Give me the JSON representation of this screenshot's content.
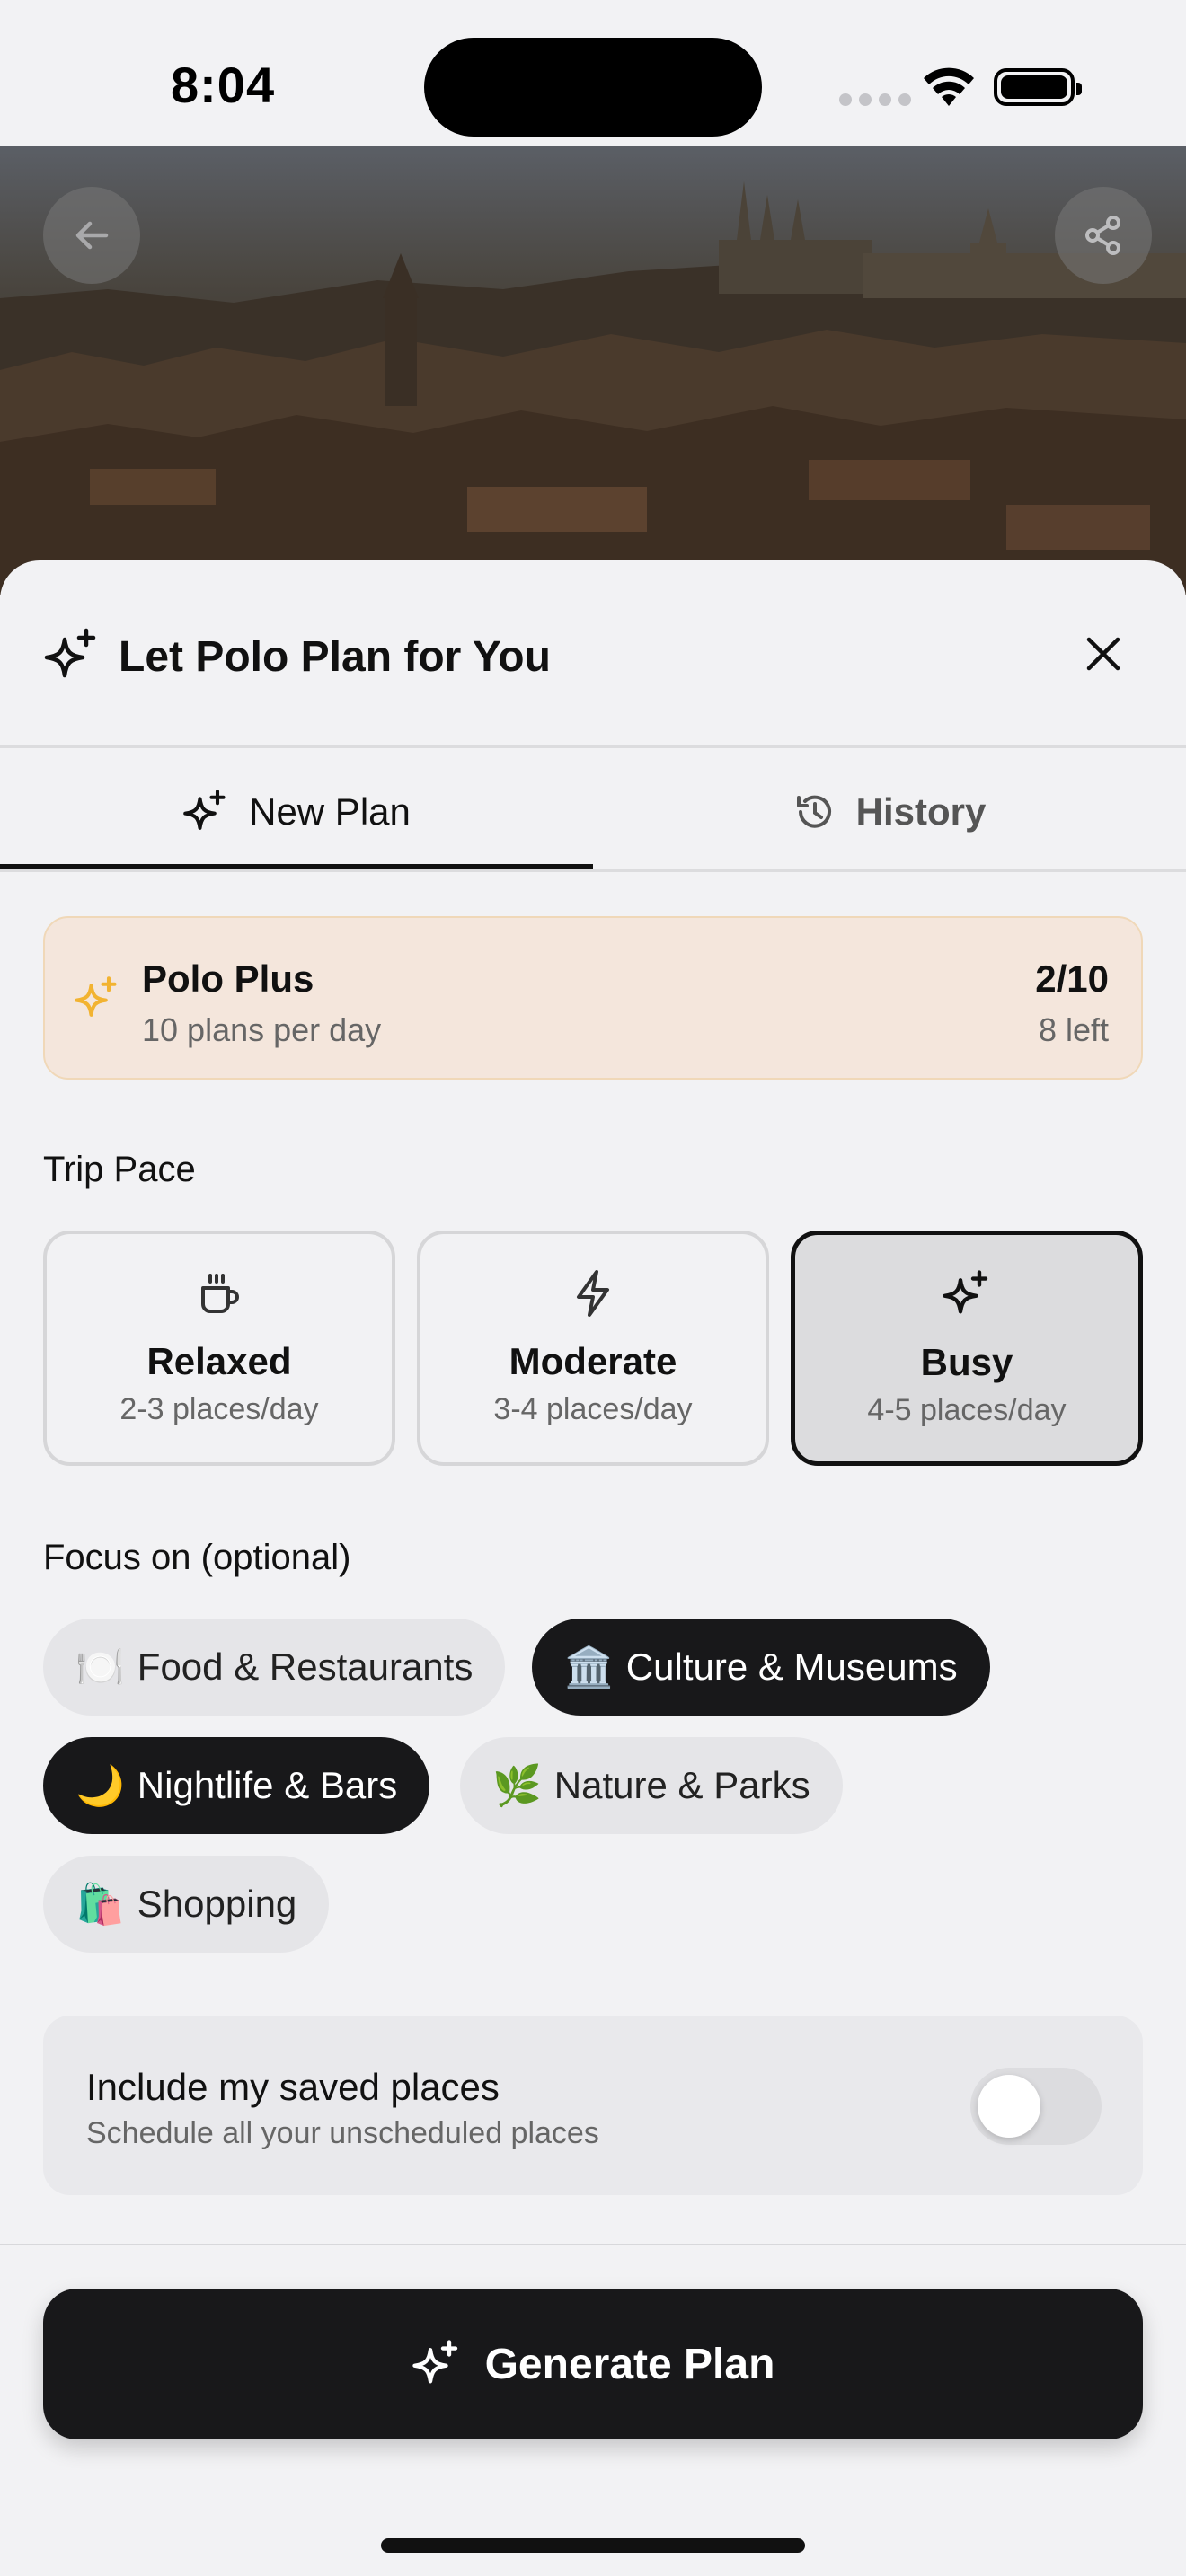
{
  "status_bar": {
    "time": "8:04"
  },
  "sheet": {
    "title": "Let Polo Plan for You",
    "tabs": [
      {
        "label": "New Plan",
        "icon": "sparkles-icon",
        "selected": true
      },
      {
        "label": "History",
        "icon": "history-icon",
        "selected": false
      }
    ]
  },
  "plan_card": {
    "name": "Polo Plus",
    "description": "10 plans per day",
    "used": "2/10",
    "remaining": "8 left",
    "accent": "#f2b331"
  },
  "trip_pace": {
    "label": "Trip Pace",
    "options": [
      {
        "name": "Relaxed",
        "detail": "2-3 places/day",
        "icon": "coffee-cup-icon",
        "selected": false
      },
      {
        "name": "Moderate",
        "detail": "3-4 places/day",
        "icon": "lightning-icon",
        "selected": false
      },
      {
        "name": "Busy",
        "detail": "4-5 places/day",
        "icon": "sparkles-icon",
        "selected": true
      }
    ]
  },
  "focus": {
    "label": "Focus on (optional)",
    "chips": [
      {
        "emoji": "🍽️",
        "label": "Food & Restaurants",
        "selected": false
      },
      {
        "emoji": "🏛️",
        "label": "Culture & Museums",
        "selected": true
      },
      {
        "emoji": "🌙",
        "label": "Nightlife & Bars",
        "selected": true
      },
      {
        "emoji": "🌿",
        "label": "Nature & Parks",
        "selected": false
      },
      {
        "emoji": "🛍️",
        "label": "Shopping",
        "selected": false
      }
    ]
  },
  "saved_places": {
    "title": "Include my saved places",
    "subtitle": "Schedule all your unscheduled places",
    "enabled": false
  },
  "generate_button": {
    "label": "Generate Plan"
  }
}
